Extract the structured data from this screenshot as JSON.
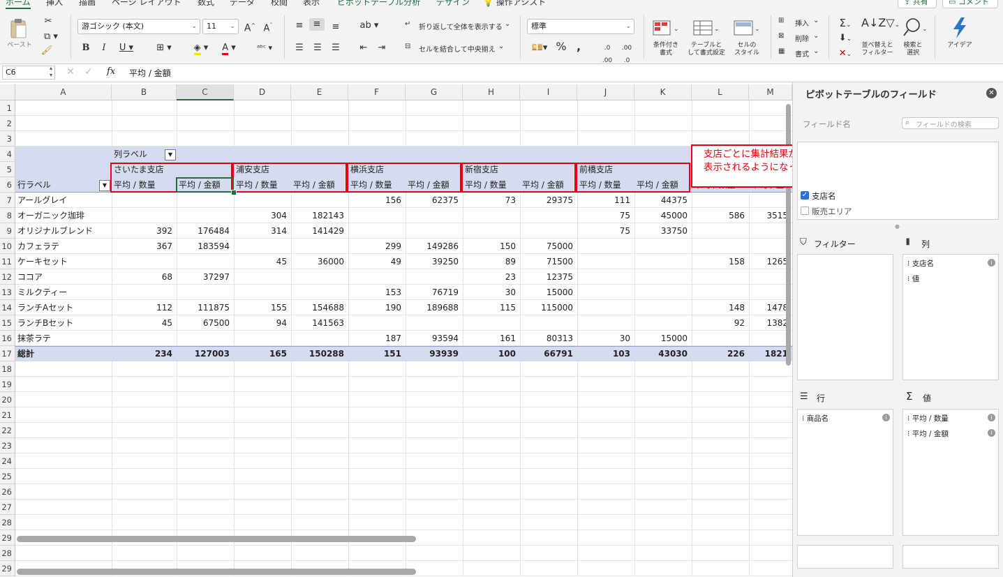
{
  "ribbon": {
    "tabs": [
      "ホーム",
      "挿入",
      "描画",
      "ページ レイアウト",
      "数式",
      "データ",
      "校閲",
      "表示",
      "ピボットテーブル分析",
      "デザイン",
      "操作アシスト"
    ],
    "share_label": "共有",
    "comment_label": "コメント",
    "paste_label": "ペースト",
    "font_name": "游ゴシック (本文)",
    "font_size": "11",
    "wrap_text_label": "折り返して全体を表示する",
    "merge_center_label": "セルを結合して中央揃え",
    "number_format": "標準",
    "conditional_format_label": [
      "条件付き",
      "書式"
    ],
    "format_as_table_label": [
      "テーブルと",
      "して書式設定"
    ],
    "cell_styles_label": [
      "セルの",
      "スタイル"
    ],
    "insert_label": "挿入",
    "delete_label": "削除",
    "format_label": "書式",
    "sort_filter_label": [
      "並べ替えと",
      "フィルター"
    ],
    "find_select_label": [
      "検索と",
      "選択"
    ],
    "ideas_label": "アイデア",
    "accent_color": "#1d6f3c"
  },
  "formula_bar": {
    "name_box": "C6",
    "fx": "fx",
    "content": "平均 / 金額"
  },
  "sheet": {
    "columns": [
      "A",
      "B",
      "C",
      "D",
      "E",
      "F",
      "G",
      "H",
      "I",
      "J",
      "K",
      "L",
      "M"
    ],
    "selected_column": "C",
    "row_numbers": [
      "1",
      "2",
      "3",
      "4",
      "5",
      "6",
      "7",
      "8",
      "9",
      "10",
      "11",
      "12",
      "13",
      "14",
      "15",
      "16",
      "17",
      "18",
      "19",
      "20",
      "21",
      "22",
      "23",
      "24",
      "25",
      "26",
      "27",
      "28",
      "29",
      "28",
      "29"
    ],
    "col_label_header": "列ラベル",
    "row_label_header": "行ラベル",
    "stores": [
      "さいたま支店",
      "浦安支店",
      "横浜支店",
      "新宿支店",
      "前橋支店"
    ],
    "measure_qty": "平均 / 数量",
    "measure_amt": "平均 / 金額",
    "partial_header_l": "平均 / 数量",
    "partial_header_m": "平均 / 金",
    "products": [
      "アールグレイ",
      "オーガニック珈琲",
      "オリジナルブレンド",
      "カフェラテ",
      "ケーキセット",
      "ココア",
      "ミルクティー",
      "ランチAセット",
      "ランチBセット",
      "抹茶ラテ"
    ],
    "values": [
      [
        "",
        "",
        "",
        "",
        "156",
        "62375",
        "73",
        "29375",
        "111",
        "44375",
        "",
        ""
      ],
      [
        "",
        "",
        "304",
        "182143",
        "",
        "",
        "",
        "",
        "75",
        "45000",
        "586",
        "3515"
      ],
      [
        "392",
        "176484",
        "314",
        "141429",
        "",
        "",
        "",
        "",
        "75",
        "33750",
        "",
        ""
      ],
      [
        "367",
        "183594",
        "",
        "",
        "299",
        "149286",
        "150",
        "75000",
        "",
        "",
        "",
        ""
      ],
      [
        "",
        "",
        "45",
        "36000",
        "49",
        "39250",
        "89",
        "71500",
        "",
        "",
        "158",
        "1265"
      ],
      [
        "68",
        "37297",
        "",
        "",
        "",
        "",
        "23",
        "12375",
        "",
        "",
        "",
        ""
      ],
      [
        "",
        "",
        "",
        "",
        "153",
        "76719",
        "30",
        "15000",
        "",
        "",
        "",
        ""
      ],
      [
        "112",
        "111875",
        "155",
        "154688",
        "190",
        "189688",
        "115",
        "115000",
        "",
        "",
        "148",
        "1478"
      ],
      [
        "45",
        "67500",
        "94",
        "141563",
        "",
        "",
        "",
        "",
        "",
        "",
        "92",
        "1382"
      ],
      [
        "",
        "",
        "",
        "",
        "187",
        "93594",
        "161",
        "80313",
        "30",
        "15000",
        "",
        ""
      ]
    ],
    "total_label": "総計",
    "totals": [
      "234",
      "127003",
      "165",
      "150288",
      "151",
      "93939",
      "100",
      "66791",
      "103",
      "43030",
      "226",
      "1821"
    ],
    "annotation": [
      "支店ごとに集計結果が",
      "表示されるようになった"
    ],
    "header_fill": "#d6dcf0",
    "annotation_color": "#e3000f"
  },
  "pane": {
    "title": "ピボットテーブルのフィールド",
    "field_name_label": "フィールド名",
    "search_placeholder": "フィールドの検索",
    "fields": [
      {
        "label": "支店名",
        "checked": true
      },
      {
        "label": "販売エリア",
        "checked": false
      }
    ],
    "filter_label": "フィルター",
    "columns_label": "列",
    "rows_label": "行",
    "values_label": "値",
    "columns_items": [
      "支店名",
      "値"
    ],
    "rows_items": [
      "商品名"
    ],
    "values_items": [
      "平均 / 数量",
      "平均 / 金額"
    ]
  }
}
